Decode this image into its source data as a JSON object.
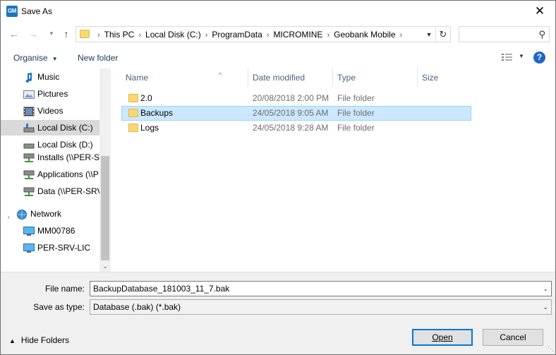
{
  "window": {
    "title": "Save As",
    "app_icon_text": "GM",
    "close_glyph": "✕"
  },
  "address": {
    "crumbs": [
      "This PC",
      "Local Disk (C:)",
      "ProgramData",
      "MICROMINE",
      "Geobank Mobile"
    ],
    "search_placeholder": ""
  },
  "toolbar": {
    "organise_label": "Organise",
    "new_folder_label": "New folder",
    "help_label": "?"
  },
  "navpane": {
    "items": [
      {
        "label": "Music",
        "icon": "music-icon"
      },
      {
        "label": "Pictures",
        "icon": "pictures-icon"
      },
      {
        "label": "Videos",
        "icon": "videos-icon"
      },
      {
        "label": "Local Disk (C:)",
        "icon": "drive-icon",
        "selected": true
      },
      {
        "label": "Local Disk (D:)",
        "icon": "drive-icon"
      },
      {
        "label": "Installs (\\\\PER-SI",
        "icon": "network-drive-icon"
      },
      {
        "label": "Applications (\\\\P",
        "icon": "network-drive-icon"
      },
      {
        "label": "Data (\\\\PER-SRV",
        "icon": "network-drive-icon"
      },
      {
        "label": "Network",
        "icon": "network-icon"
      },
      {
        "label": "MM00786",
        "icon": "computer-icon"
      },
      {
        "label": "PER-SRV-LIC",
        "icon": "computer-icon"
      }
    ]
  },
  "filelist": {
    "columns": [
      "Name",
      "Date modified",
      "Type",
      "Size"
    ],
    "rows": [
      {
        "name": "2.0",
        "date": "20/08/2018 2:00 PM",
        "type": "File folder",
        "selected": false
      },
      {
        "name": "Backups",
        "date": "24/05/2018 9:05 AM",
        "type": "File folder",
        "selected": true
      },
      {
        "name": "Logs",
        "date": "24/05/2018 9:28 AM",
        "type": "File folder",
        "selected": false
      }
    ]
  },
  "form": {
    "file_name_label": "File name:",
    "file_name_value": "BackupDatabase_181003_11_7.bak",
    "save_type_label": "Save as type:",
    "save_type_value": "Database (.bak) (*.bak)",
    "hide_folders_label": "Hide Folders",
    "open_label": "Open",
    "cancel_label": "Cancel"
  },
  "colors": {
    "accent": "#0078d7",
    "selection": "#cce8ff",
    "folder": "#f8d775"
  }
}
